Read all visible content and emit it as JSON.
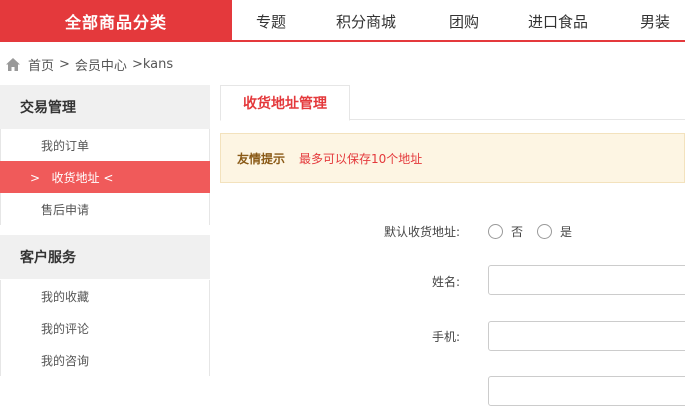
{
  "topnav": {
    "all_categories": "全部商品分类",
    "items": [
      "专题",
      "积分商城",
      "团购",
      "进口食品",
      "男装"
    ]
  },
  "breadcrumb": {
    "home": "首页",
    "sep1": ">",
    "member": "会员中心",
    "current": ">kans"
  },
  "sidebar": {
    "groups": [
      {
        "title": "交易管理",
        "items": [
          "我的订单",
          ">   收货地址 <",
          "售后申请"
        ]
      },
      {
        "title": "客户服务",
        "items": [
          "我的收藏",
          "我的评论",
          "我的咨询"
        ]
      }
    ]
  },
  "content": {
    "tab": "收货地址管理",
    "tip_title": "友情提示",
    "tip_text": "最多可以保存10个地址",
    "default_label": "默认收货地址:",
    "option_no": "否",
    "option_yes": "是",
    "name_label": "姓名:",
    "phone_label": "手机:"
  },
  "colors": {
    "accent": "#e4393c",
    "active_item": "#f05a5a",
    "tip_bg": "#fdf5e3"
  }
}
